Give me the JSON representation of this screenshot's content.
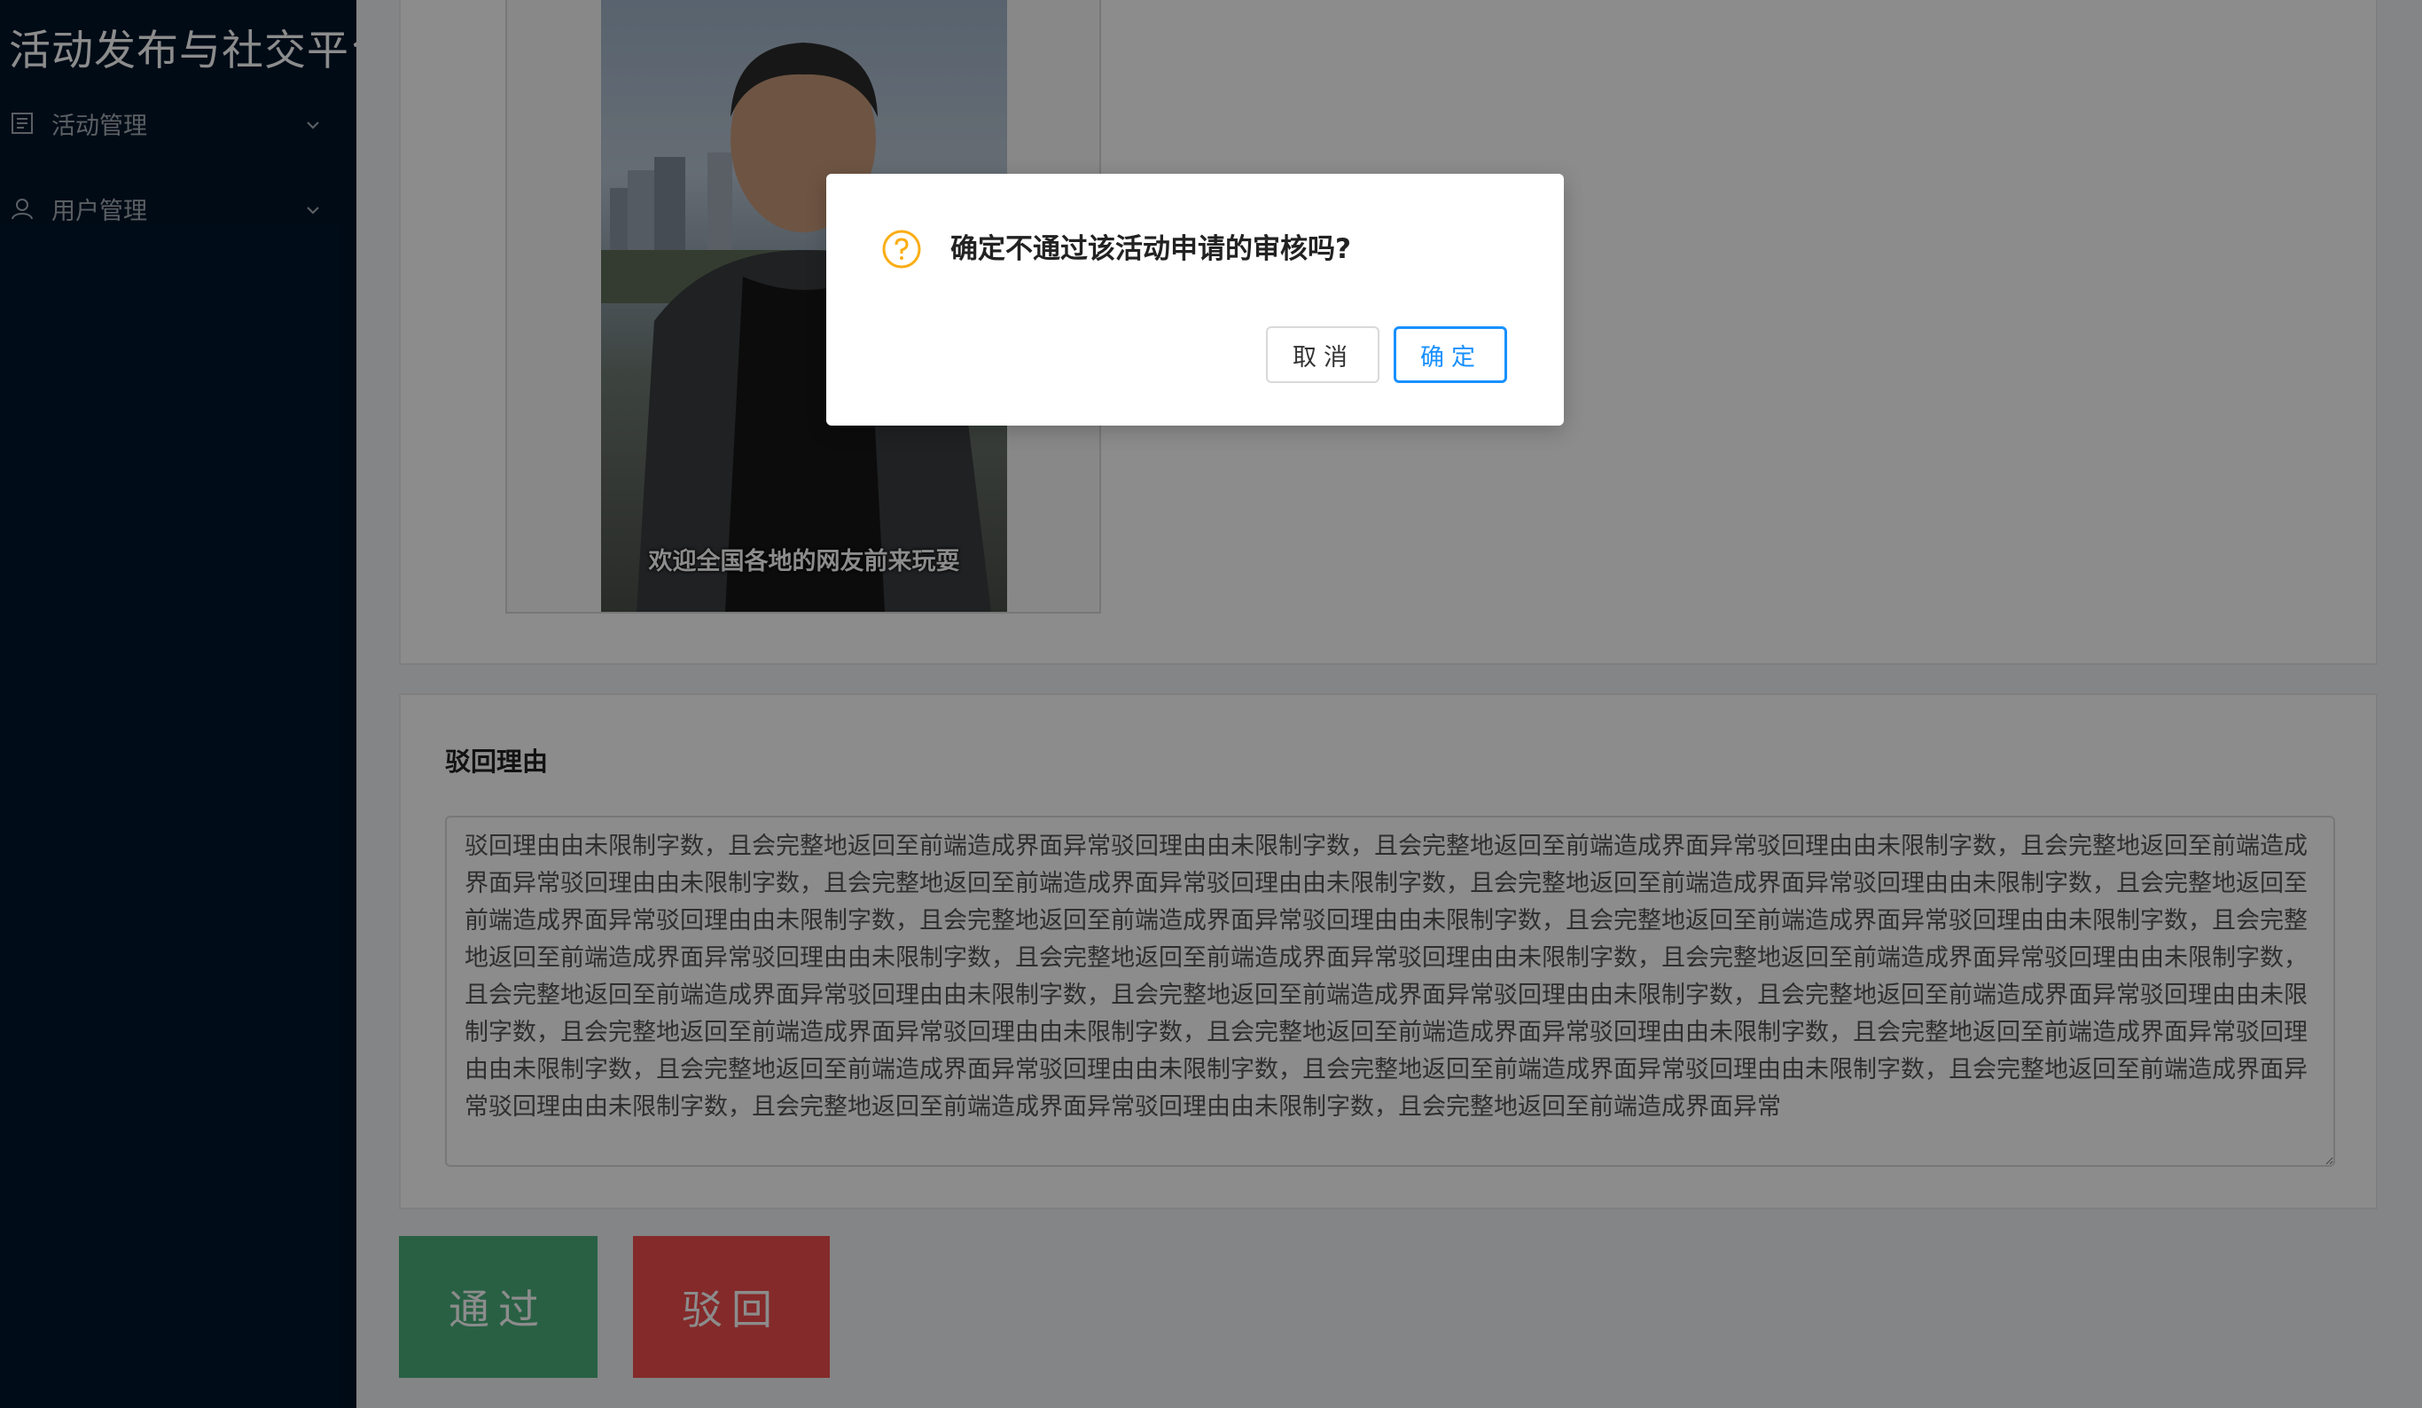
{
  "sidebar": {
    "brand": "活动发布与社交平台",
    "items": [
      {
        "label": "活动管理",
        "icon": "activity-list-icon"
      },
      {
        "label": "用户管理",
        "icon": "user-icon"
      }
    ]
  },
  "main": {
    "image_caption": "欢迎全国各地的网友前来玩耍",
    "reason": {
      "title": "驳回理由",
      "text": "驳回理由由未限制字数，且会完整地返回至前端造成界面异常驳回理由由未限制字数，且会完整地返回至前端造成界面异常驳回理由由未限制字数，且会完整地返回至前端造成界面异常驳回理由由未限制字数，且会完整地返回至前端造成界面异常驳回理由由未限制字数，且会完整地返回至前端造成界面异常驳回理由由未限制字数，且会完整地返回至前端造成界面异常驳回理由由未限制字数，且会完整地返回至前端造成界面异常驳回理由由未限制字数，且会完整地返回至前端造成界面异常驳回理由由未限制字数，且会完整地返回至前端造成界面异常驳回理由由未限制字数，且会完整地返回至前端造成界面异常驳回理由由未限制字数，且会完整地返回至前端造成界面异常驳回理由由未限制字数，且会完整地返回至前端造成界面异常驳回理由由未限制字数，且会完整地返回至前端造成界面异常驳回理由由未限制字数，且会完整地返回至前端造成界面异常驳回理由由未限制字数，且会完整地返回至前端造成界面异常驳回理由由未限制字数，且会完整地返回至前端造成界面异常驳回理由由未限制字数，且会完整地返回至前端造成界面异常驳回理由由未限制字数，且会完整地返回至前端造成界面异常驳回理由由未限制字数，且会完整地返回至前端造成界面异常驳回理由由未限制字数，且会完整地返回至前端造成界面异常驳回理由由未限制字数，且会完整地返回至前端造成界面异常驳回理由由未限制字数，且会完整地返回至前端造成界面异常"
    },
    "pass_label": "通过",
    "reject_label": "驳回"
  },
  "modal": {
    "title": "确定不通过该活动申请的审核吗?",
    "icon": "question-circle-icon",
    "cancel_label": "取消",
    "ok_label": "确定"
  },
  "colors": {
    "sidebar_bg": "#001529",
    "pass": "#4caf7d",
    "reject": "#f04d4d",
    "primary": "#1890ff",
    "warning": "#faad14"
  }
}
